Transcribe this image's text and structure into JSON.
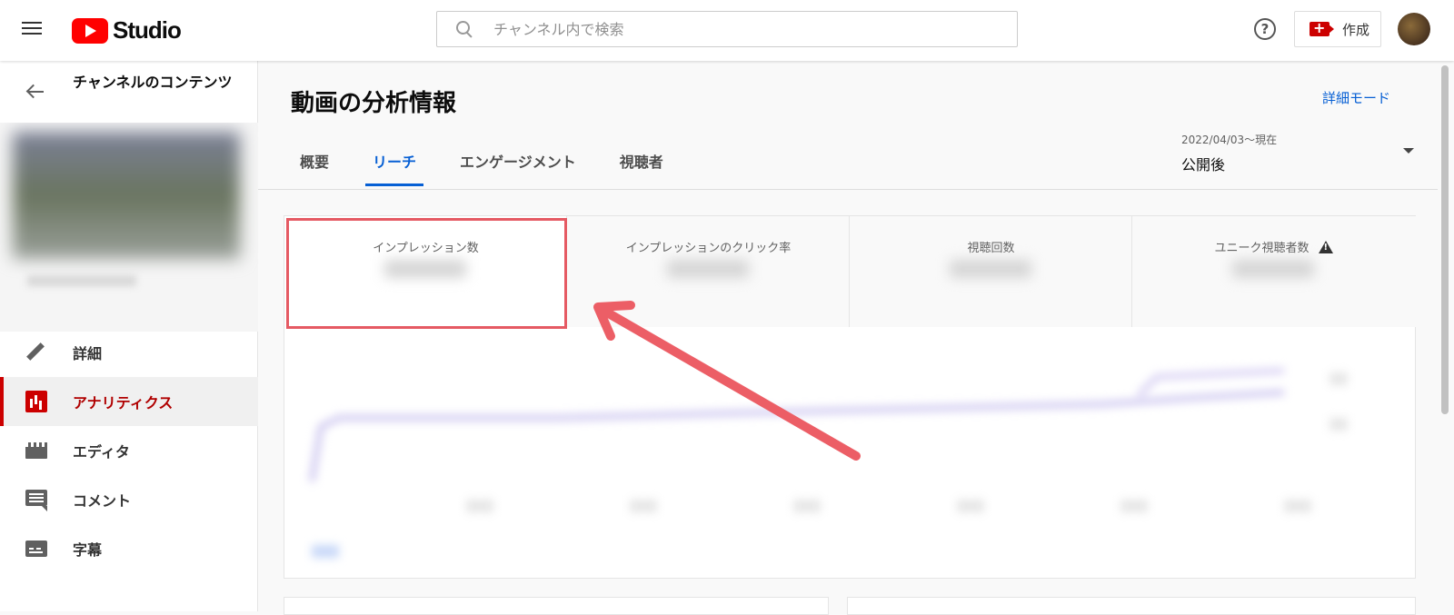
{
  "header": {
    "logo_text": "Studio",
    "search_placeholder": "チャンネル内で検索",
    "create_label": "作成",
    "help_symbol": "?"
  },
  "sidebar": {
    "back_title": "チャンネルのコンテンツ",
    "items": [
      {
        "label": "詳細",
        "icon": "pencil-icon",
        "active": false
      },
      {
        "label": "アナリティクス",
        "icon": "analytics-icon",
        "active": true
      },
      {
        "label": "エディタ",
        "icon": "editor-icon",
        "active": false
      },
      {
        "label": "コメント",
        "icon": "comment-icon",
        "active": false
      },
      {
        "label": "字幕",
        "icon": "subtitle-icon",
        "active": false
      }
    ]
  },
  "main": {
    "title": "動画の分析情報",
    "advanced_mode": "詳細モード",
    "tabs": [
      {
        "label": "概要",
        "active": false
      },
      {
        "label": "リーチ",
        "active": true
      },
      {
        "label": "エンゲージメント",
        "active": false
      },
      {
        "label": "視聴者",
        "active": false
      }
    ],
    "date_range": {
      "range": "2022/04/03〜現在",
      "label": "公開後"
    },
    "metrics": [
      {
        "label": "インプレッション数",
        "highlighted": true
      },
      {
        "label": "インプレッションのクリック率"
      },
      {
        "label": "視聴回数"
      },
      {
        "label": "ユニーク視聴者数",
        "warning": true
      }
    ]
  },
  "colors": {
    "brand_red": "#ff0000",
    "accent_blue": "#065fd4",
    "active_red": "#cc0000",
    "annotation": "#e55a63"
  }
}
